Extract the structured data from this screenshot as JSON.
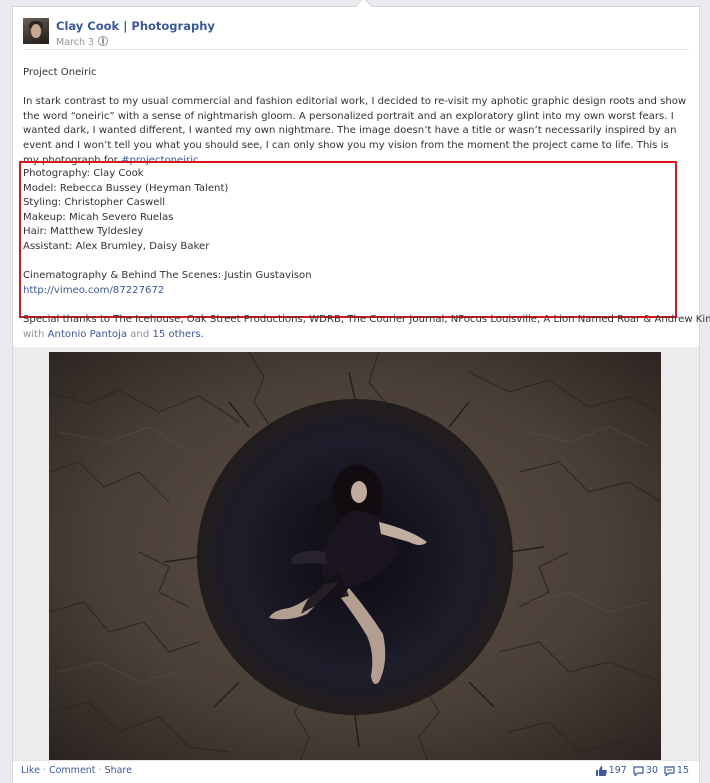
{
  "post": {
    "author": "Clay Cook",
    "separator": "|",
    "page": "Photography",
    "date": "March 3",
    "title": "Project Oneiric",
    "body": "In stark contrast to my usual commercial and fashion editorial work, I decided to re-visit my aphotic graphic design roots and show the word “oneiric” with a sense of nightmarish gloom. A personalized portrait and an exploratory glint into my own worst fears. I wanted dark, I wanted different, I wanted my own nightmare. The image doesn’t have a title or wasn’t necessarily inspired by an event and I won’t tell you what you should see, I can only show you my vision from the moment the project came to life. This is my photograph for",
    "hashtag": "#projectoneiric"
  },
  "credits": {
    "lines": [
      "Photography: Clay Cook",
      "Model: Rebecca Bussey (Heyman Talent)",
      "Styling: Christopher Caswell",
      "Makeup: Micah Severo Ruelas",
      "Hair: Matthew Tyldesley",
      "Assistant: Alex Brumley, Daisy Baker"
    ],
    "cinematography": "Cinematography & Behind The Scenes: Justin Gustavison",
    "link": "http://vimeo.com/87227672",
    "thanks": "Special thanks to The Icehouse, Oak Street Productions, WDRB, The Courier Journal, NFocus Louisville, A Lion Named Roar & Andrew Kim —",
    "with_prefix": "with",
    "tagged_person": "Antonio Pantoja",
    "and": "and",
    "others": "15 others."
  },
  "footer": {
    "like": "Like",
    "comment": "Comment",
    "share": "Share",
    "dot": "·",
    "likes_count": "197",
    "comments_count": "30",
    "shares_count": "15"
  },
  "colors": {
    "link": "#3b5998",
    "highlight": "#d8161c",
    "meta": "#90949c"
  },
  "icons": [
    "globe-icon",
    "thumbs-up-icon",
    "comment-icon",
    "share-icon"
  ]
}
